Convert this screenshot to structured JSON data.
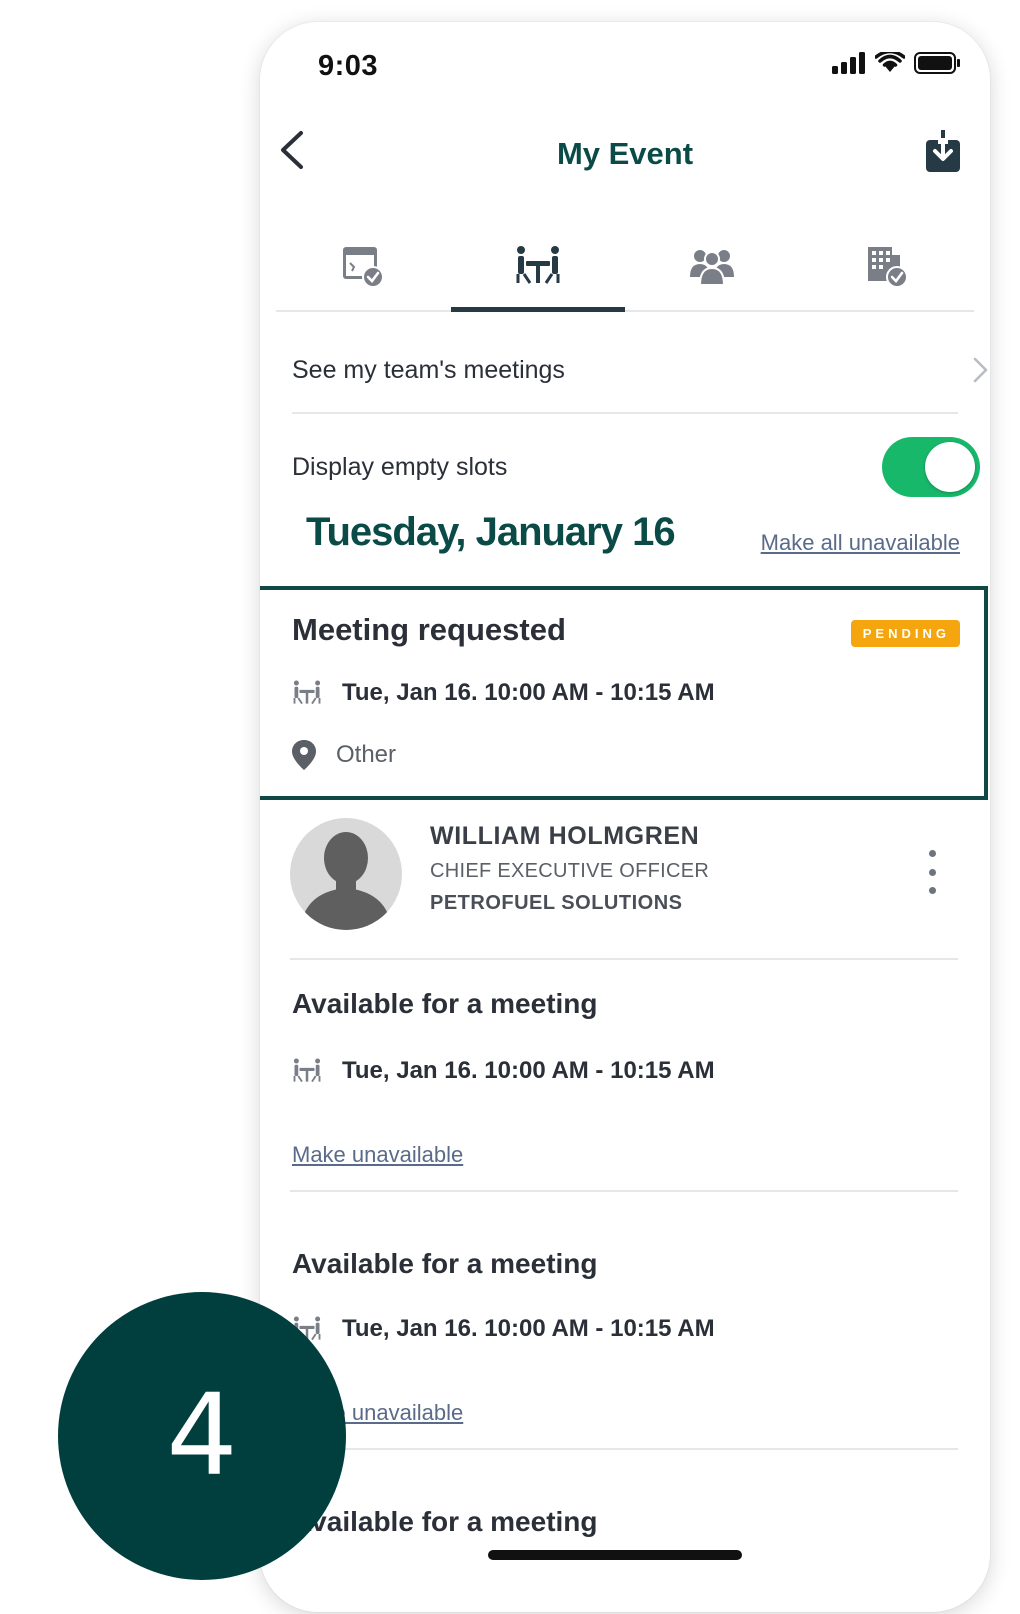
{
  "status_bar": {
    "time": "9:03"
  },
  "header": {
    "title": "My Event"
  },
  "tabs": [
    {
      "icon": "calendar-check-icon",
      "active": false
    },
    {
      "icon": "meeting-table-icon",
      "active": true
    },
    {
      "icon": "people-group-icon",
      "active": false
    },
    {
      "icon": "building-check-icon",
      "active": false
    }
  ],
  "team_link": {
    "label": "See my team's meetings"
  },
  "empty_slots": {
    "label": "Display empty slots",
    "enabled": true
  },
  "day": {
    "heading": "Tuesday, January 16",
    "make_all_unavailable": "Make all unavailable"
  },
  "meeting_request": {
    "title": "Meeting requested",
    "status": "PENDING",
    "time": "Tue, Jan 16.  10:00 AM - 10:15 AM",
    "location": "Other"
  },
  "attendee": {
    "name": "WILLIAM HOLMGREN",
    "job_title": "CHIEF EXECUTIVE OFFICER",
    "company": "PETROFUEL SOLUTIONS"
  },
  "slots": [
    {
      "title": "Available for a meeting",
      "time": "Tue, Jan 16.  10:00 AM - 10:15 AM",
      "action": "Make unavailable"
    },
    {
      "title": "Available for a meeting",
      "time": "Tue, Jan 16.  10:00 AM - 10:15 AM",
      "action": "Make unavailable"
    },
    {
      "title": "Available for a meeting"
    }
  ],
  "step_badge": {
    "number": "4"
  },
  "colors": {
    "brand": "#0a4b47",
    "toggle_on": "#18b86b",
    "pending": "#f5a50d",
    "badge": "#003f3e"
  }
}
